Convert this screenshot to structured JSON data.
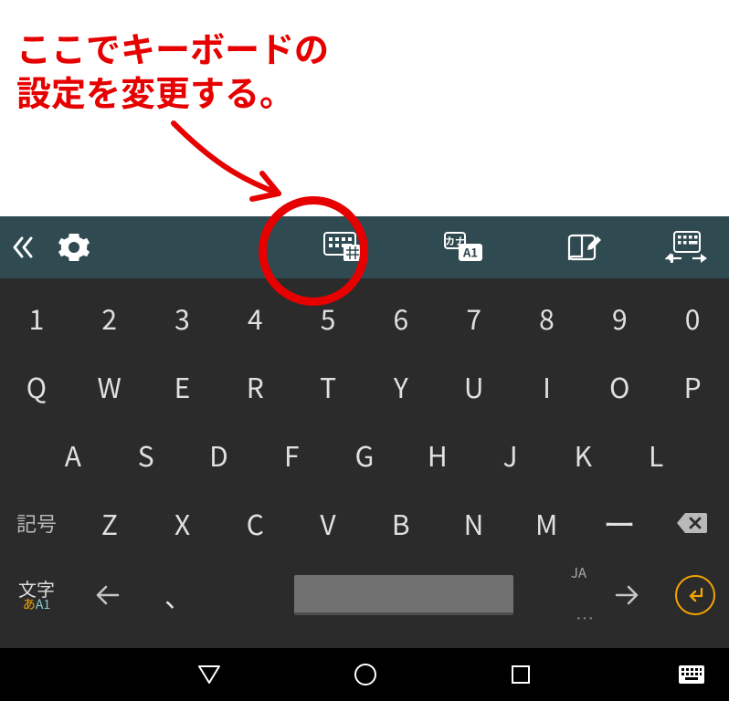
{
  "annotation": {
    "line1": "ここでキーボードの",
    "line2": "設定を変更する。",
    "circle_color": "#e60000"
  },
  "toolbar": {
    "collapse_label": "《"
  },
  "keyboard": {
    "row1": [
      "1",
      "2",
      "3",
      "4",
      "5",
      "6",
      "7",
      "8",
      "9",
      "0"
    ],
    "row2": [
      "Q",
      "W",
      "E",
      "R",
      "T",
      "Y",
      "U",
      "I",
      "O",
      "P"
    ],
    "row3": [
      "A",
      "S",
      "D",
      "F",
      "G",
      "H",
      "J",
      "K",
      "L"
    ],
    "row4_symbol_label": "記号",
    "row4_letters": [
      "Z",
      "X",
      "C",
      "V",
      "B",
      "N",
      "M"
    ],
    "row4_dash": "ー",
    "row5_moji_top": "文字",
    "row5_moji_a": "あ",
    "row5_moji_A1": "A1",
    "row5_comma": "、",
    "row5_ja_tag": "JA",
    "row5_overflow": "…"
  },
  "colors": {
    "toolbar_bg": "#2f4a50",
    "kbd_bg": "#2b2b2b",
    "accent": "#f5a400",
    "annotation_red": "#e60000"
  }
}
